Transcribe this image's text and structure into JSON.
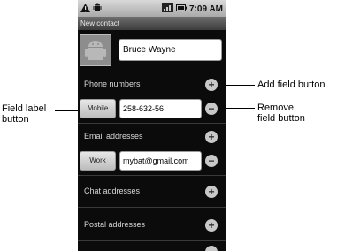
{
  "status_bar": {
    "time": "7:09 AM"
  },
  "title_bar": {
    "title": "New contact"
  },
  "contact": {
    "name": "Bruce Wayne"
  },
  "sections": {
    "phone": "Phone numbers",
    "email": "Email addresses",
    "chat": "Chat addresses",
    "postal": "Postal addresses"
  },
  "phone_entry": {
    "label": "Mobile",
    "value": "258-632-56"
  },
  "email_entry": {
    "label": "Work",
    "value": "mybat@gmail.com"
  },
  "icons": {
    "add": "+",
    "remove": "−"
  },
  "callouts": {
    "add_field": "Add field button",
    "remove_field_line1": "Remove",
    "remove_field_line2": "field button",
    "field_label_line1": "Field label",
    "field_label_line2": "button"
  }
}
